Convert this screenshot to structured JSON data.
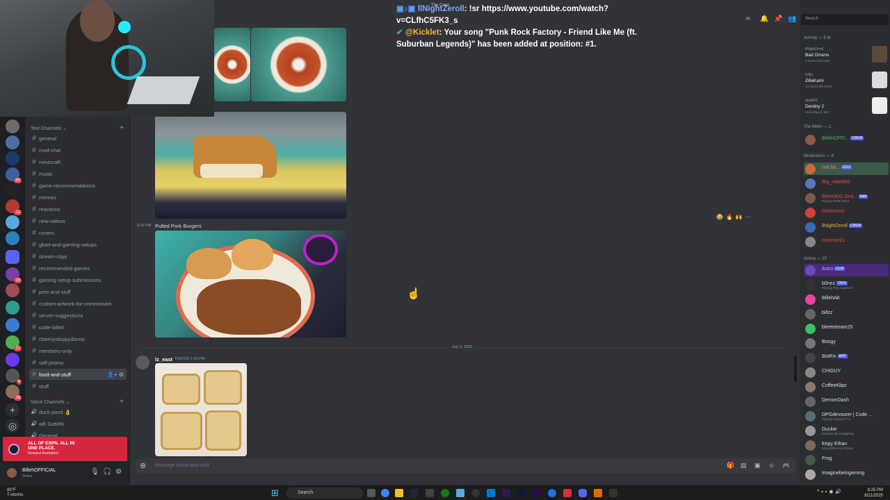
{
  "stream_chat": {
    "line1_user": "llNightZeroll",
    "line1_text": ": !sr https://www.youtube.com/watch?v=CLfhC5FK3_s",
    "line2_user": "@Kicklet",
    "line2_text": ": Your song \"Punk Rock Factory - Friend Like Me (ft. Suburban Legends)\" has been added at position: #1.",
    "crew_label": "The Crew"
  },
  "sidebar": {
    "text_category": "Text Channels",
    "channels": [
      {
        "label": "general"
      },
      {
        "label": "mod-chat"
      },
      {
        "label": "minecraft"
      },
      {
        "label": "music"
      },
      {
        "label": "game-recommendations"
      },
      {
        "label": "memes"
      },
      {
        "label": "reactions"
      },
      {
        "label": "new-videos"
      },
      {
        "label": "covers"
      },
      {
        "label": "gfuel-and-gaming-setups"
      },
      {
        "label": "stream-clips"
      },
      {
        "label": "recommended-games"
      },
      {
        "label": "gaming-setup-submissions"
      },
      {
        "label": "pets-and-stuff"
      },
      {
        "label": "custom-artwork-for-commission"
      },
      {
        "label": "server-suggestions"
      },
      {
        "label": "code-billeh"
      },
      {
        "label": "cheesysloppydonos"
      },
      {
        "label": "members-only"
      },
      {
        "label": "self-promo"
      },
      {
        "label": "food-and-stuff"
      },
      {
        "label": "stuff"
      }
    ],
    "voice_category": "Voice Channels",
    "voice_channels": [
      {
        "label": "duck pond 👌"
      },
      {
        "label": "wE GaMiN"
      },
      {
        "label": "General"
      }
    ]
  },
  "promo": {
    "title": "ALL OF ESPN. ALL IN ONE PLACE.",
    "subtitle": "Reward Available!"
  },
  "user": {
    "name": "BillehOFFICIAL",
    "status": "Online"
  },
  "messages": {
    "caption_time": "6:29 PM",
    "caption": "Pulled Pork Burgers",
    "day_divider": "July 9, 2025",
    "author": "lz_east",
    "author_time": "7/9/2025 1:50 PM"
  },
  "composer": {
    "placeholder": "Message #food-and-stuff"
  },
  "members": {
    "search_placeholder": "Search",
    "activity_header": "Activity — 5",
    "activities": [
      {
        "user": "llNightZeroll",
        "title": "Bad Omens",
        "sub": "6 tracks this week"
      },
      {
        "user": "Kiffer",
        "title": "ZillaKami",
        "sub": "12 tracks this week"
      },
      {
        "user": "Jpat863",
        "title": "Destiny 2",
        "sub": "Most played: 52h"
      }
    ],
    "billeh_header": "The Billeh — 1",
    "billeh": [
      {
        "name": "BillehOFFI...",
        "tag": "CREW"
      }
    ],
    "mods_header": "Moderators — 6",
    "mods": [
      {
        "name": "hell bit...",
        "tag": "EGG",
        "color": "#f47b67"
      },
      {
        "name": "Big_mike650",
        "tag": "",
        "color": "#f23f43"
      },
      {
        "name": "Bleet(BIG Ded...",
        "tag": "kate",
        "sub": "Playing WWE 2K24",
        "color": "#f23f43"
      },
      {
        "name": "Darkstorm",
        "tag": "",
        "color": "#f23f43"
      },
      {
        "name": "llNightZeroll",
        "tag": "CREW",
        "color": "#f0b232"
      },
      {
        "name": "masroor21",
        "tag": "",
        "color": "#f23f43"
      }
    ],
    "online_header": "Online — 37",
    "online": [
      {
        "name": "Astro",
        "tag": "CUH",
        "color": "#c9a0ff"
      },
      {
        "name": "b0nez",
        "tag": "TBOI",
        "sub": "Playing Tiny Aquarium",
        "color": "#dbdee1"
      },
      {
        "name": "BillehAlt",
        "tag": "",
        "color": "#dbdee1"
      },
      {
        "name": "billzz",
        "tag": "",
        "color": "#dbdee1"
      },
      {
        "name": "bleetstream25",
        "tag": "",
        "color": "#dbdee1"
      },
      {
        "name": "Boogy",
        "tag": "",
        "color": "#dbdee1"
      },
      {
        "name": "BotRix",
        "tag": "APP",
        "color": "#dbdee1"
      },
      {
        "name": "CHIGUY",
        "tag": "",
        "color": "#dbdee1"
      },
      {
        "name": "CoffeeKlipz",
        "tag": "",
        "color": "#dbdee1"
      },
      {
        "name": "DemonDash",
        "tag": "",
        "color": "#dbdee1"
      },
      {
        "name": "DPGdevourer | Code ...",
        "tag": "",
        "sub": "Playing Injustice™ 2",
        "color": "#dbdee1"
      },
      {
        "name": "Duckie",
        "tag": "",
        "sub": "Shadow the Hedgehog",
        "color": "#dbdee1"
      },
      {
        "name": "Eepy Ethan",
        "tag": "",
        "sub": "Stay yellow my fellows",
        "color": "#dbdee1"
      },
      {
        "name": "Frog",
        "tag": "",
        "color": "#dbdee1"
      },
      {
        "name": "Imaginebeingwrong",
        "tag": "",
        "color": "#dbdee1"
      }
    ]
  },
  "taskbar": {
    "weather_temp": "80°F",
    "weather_desc": "T-storms",
    "search": "Search",
    "time": "8:25 PM",
    "date": "8/21/2025"
  },
  "server_pings": [
    "84",
    "12",
    "19",
    "21",
    "4",
    "16"
  ]
}
